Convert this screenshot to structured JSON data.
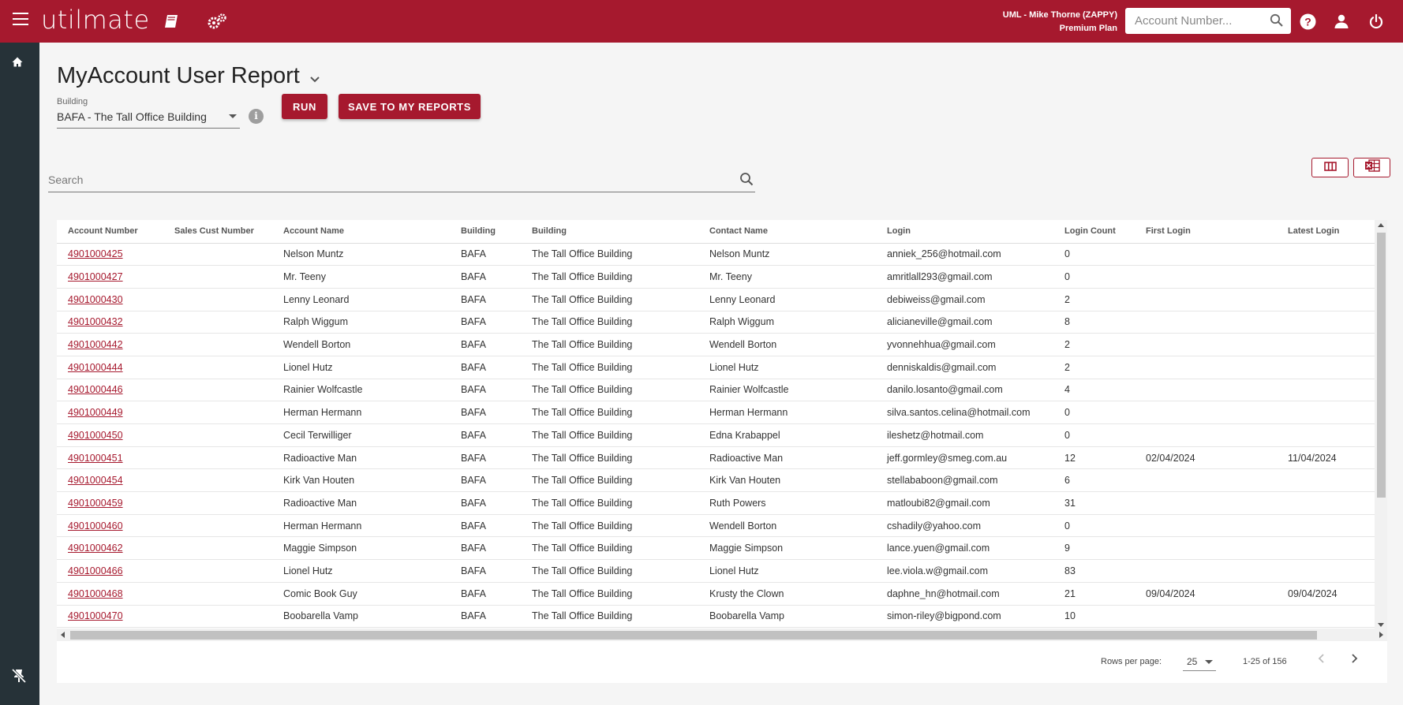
{
  "app": {
    "logo": "utilmate",
    "user_line1": "UML - Mike Thorne (ZAPPY)",
    "user_line2": "Premium Plan",
    "account_search_placeholder": "Account Number...",
    "brand_color": "#a6192e"
  },
  "page": {
    "title": "MyAccount User Report",
    "building_label": "Building",
    "building_value": "BAFA - The Tall Office Building",
    "run_label": "RUN",
    "save_label": "SAVE TO MY REPORTS",
    "search_placeholder": "Search"
  },
  "table": {
    "headers": [
      "Account Number",
      "Sales Cust Number",
      "Account Name",
      "Building",
      "Building",
      "Contact Name",
      "Login",
      "Login Count",
      "First Login",
      "Latest Login"
    ],
    "rows": [
      [
        "4901000425",
        "",
        "Nelson Muntz",
        "BAFA",
        "The Tall Office Building",
        "Nelson Muntz",
        "anniek_256@hotmail.com",
        "0",
        "",
        ""
      ],
      [
        "4901000427",
        "",
        "Mr. Teeny",
        "BAFA",
        "The Tall Office Building",
        "Mr. Teeny",
        "amritlall293@gmail.com",
        "0",
        "",
        ""
      ],
      [
        "4901000430",
        "",
        "Lenny Leonard",
        "BAFA",
        "The Tall Office Building",
        "Lenny Leonard",
        "debiweiss@gmail.com",
        "2",
        "",
        ""
      ],
      [
        "4901000432",
        "",
        "Ralph Wiggum",
        "BAFA",
        "The Tall Office Building",
        "Ralph Wiggum",
        "alicianeville@gmail.com",
        "8",
        "",
        ""
      ],
      [
        "4901000442",
        "",
        "Wendell Borton",
        "BAFA",
        "The Tall Office Building",
        "Wendell Borton",
        "yvonnehhua@gmail.com",
        "2",
        "",
        ""
      ],
      [
        "4901000444",
        "",
        "Lionel Hutz",
        "BAFA",
        "The Tall Office Building",
        "Lionel Hutz",
        "denniskaldis@gmail.com",
        "2",
        "",
        ""
      ],
      [
        "4901000446",
        "",
        "Rainier Wolfcastle",
        "BAFA",
        "The Tall Office Building",
        "Rainier Wolfcastle",
        "danilo.losanto@gmail.com",
        "4",
        "",
        ""
      ],
      [
        "4901000449",
        "",
        "Herman Hermann",
        "BAFA",
        "The Tall Office Building",
        "Herman Hermann",
        "silva.santos.celina@hotmail.com",
        "0",
        "",
        ""
      ],
      [
        "4901000450",
        "",
        "Cecil Terwilliger",
        "BAFA",
        "The Tall Office Building",
        "Edna Krabappel",
        "ileshetz@hotmail.com",
        "0",
        "",
        ""
      ],
      [
        "4901000451",
        "",
        "Radioactive Man",
        "BAFA",
        "The Tall Office Building",
        "Radioactive Man",
        "jeff.gormley@smeg.com.au",
        "12",
        "02/04/2024",
        "11/04/2024"
      ],
      [
        "4901000454",
        "",
        "Kirk Van Houten",
        "BAFA",
        "The Tall Office Building",
        "Kirk Van Houten",
        "stellababoon@gmail.com",
        "6",
        "",
        ""
      ],
      [
        "4901000459",
        "",
        "Radioactive Man",
        "BAFA",
        "The Tall Office Building",
        "Ruth Powers",
        "matloubi82@gmail.com",
        "31",
        "",
        ""
      ],
      [
        "4901000460",
        "",
        "Herman Hermann",
        "BAFA",
        "The Tall Office Building",
        "Wendell Borton",
        "cshadily@yahoo.com",
        "0",
        "",
        ""
      ],
      [
        "4901000462",
        "",
        "Maggie Simpson",
        "BAFA",
        "The Tall Office Building",
        "Maggie Simpson",
        "lance.yuen@gmail.com",
        "9",
        "",
        ""
      ],
      [
        "4901000466",
        "",
        "Lionel Hutz",
        "BAFA",
        "The Tall Office Building",
        "Lionel Hutz",
        "lee.viola.w@gmail.com",
        "83",
        "",
        ""
      ],
      [
        "4901000468",
        "",
        "Comic Book Guy",
        "BAFA",
        "The Tall Office Building",
        "Krusty the Clown",
        "daphne_hn@hotmail.com",
        "21",
        "09/04/2024",
        "09/04/2024"
      ],
      [
        "4901000470",
        "",
        "Boobarella Vamp",
        "BAFA",
        "The Tall Office Building",
        "Boobarella Vamp",
        "simon-riley@bigpond.com",
        "10",
        "",
        ""
      ]
    ]
  },
  "pager": {
    "rows_per_page_label": "Rows per page:",
    "rows_per_page": "25",
    "range": "1-25 of 156"
  }
}
